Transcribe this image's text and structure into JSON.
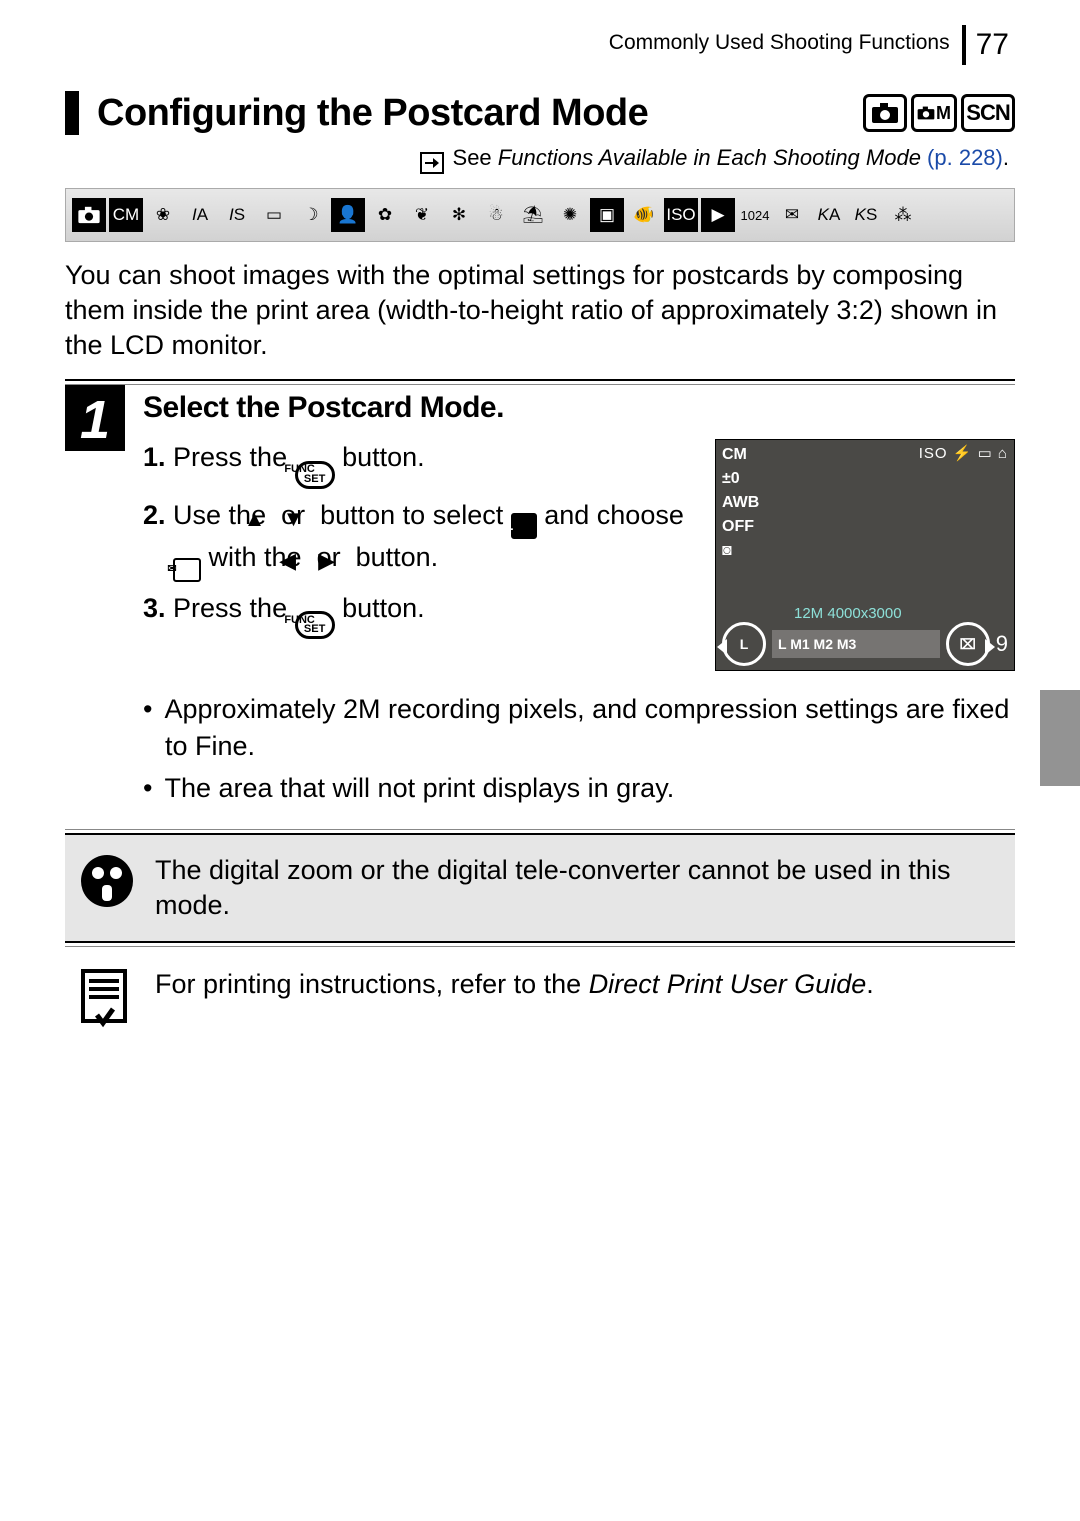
{
  "header": {
    "section": "Commonly Used Shooting Functions",
    "page": "77"
  },
  "title": "Configuring the Postcard Mode",
  "mode_badges": [
    "camera",
    "CM",
    "SCN"
  ],
  "see_line": {
    "prefix": "See ",
    "italic": "Functions Available in Each Shooting Mode",
    "link": " (p. 228)",
    "suffix": "."
  },
  "intro": "You can shoot images with the optimal settings for postcards by composing them inside the print area (width-to-height ratio of approximately 3:2) shown in the LCD monitor.",
  "step": {
    "number": "1",
    "title": "Select the Postcard Mode.",
    "items": {
      "n1": "1.",
      "t1a": " Press the ",
      "func": "FUNC\nSET",
      "t1b": " button.",
      "n2": "2.",
      "t2a": " Use the ",
      "up": "▲",
      "t2b": " or ",
      "down": "▼",
      "t2c": " button to select ",
      "l_icon": "L",
      "t2d": " and choose ",
      "postcard_icon": "⌧",
      "t2e": " with the ",
      "left": "◀",
      "t2f": " or ",
      "right": "▶",
      "t2g": " button.",
      "n3": "3.",
      "t3a": " Press the ",
      "t3b": " button."
    }
  },
  "lcd": {
    "cm": "CM",
    "ev": "±0",
    "awb": "AWB",
    "off": "OFF",
    "meter": "◙",
    "topright": "ISO ⚡ ▭ ⌂",
    "caption": "12M  4000x3000",
    "l": "L",
    "m_row": "L  M1 M2 M3",
    "r": "⌧",
    "nine": "9"
  },
  "bullets": [
    "Approximately 2M recording pixels, and compression settings are fixed to Fine.",
    "The area that will not print displays in gray."
  ],
  "warning": "The digital zoom or the digital tele-converter cannot be used in this mode.",
  "printer_note": {
    "pre": "For printing instructions, refer to the ",
    "italic": "Direct Print User Guide",
    "post": "."
  }
}
